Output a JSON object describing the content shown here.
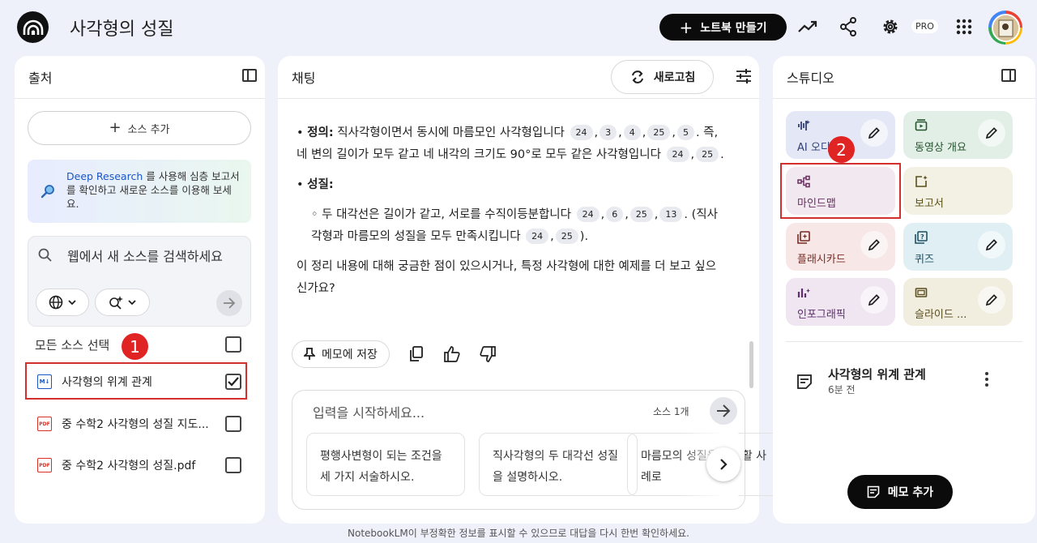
{
  "header": {
    "notebook_title": "사각형의 성질",
    "new_notebook_label": "노트북 만들기",
    "pro_badge": "PRO"
  },
  "sources_panel": {
    "title": "출처",
    "add_source_label": "소스 추가",
    "deep_research": {
      "link_text": "Deep Research",
      "text": " 를 사용해 심층 보고서를 확인하고 새로운 소스를 이용해 보세요."
    },
    "search_placeholder": "웹에서 새 소스를 검색하세요",
    "select_all_label": "모든 소스 선택",
    "sources": [
      {
        "name": "사각형의 위계 관계",
        "type": "doc",
        "checked": true
      },
      {
        "name": "중 수학2 사각형의 성질 지도...",
        "type": "pdf",
        "checked": false
      },
      {
        "name": "중 수학2 사각형의 성질.pdf",
        "type": "pdf",
        "checked": false
      }
    ]
  },
  "chat_panel": {
    "title": "채팅",
    "refresh_label": "새로고침",
    "definition_label": "정의:",
    "definition_text": "직사각형이면서 동시에 마름모인 사각형입니다",
    "definition_cites": [
      "24",
      "3",
      "4",
      "25",
      "5"
    ],
    "definition_text2": "즉, 네 변의 길이가 모두 같고 네 내각의 크기도 90°로 모두 같은 사각형입니다",
    "definition_cites2": [
      "24",
      "25"
    ],
    "property_label": "성질:",
    "property_text": "두 대각선은 길이가 같고, 서로를 수직이등분합니다",
    "property_cites": [
      "24",
      "6",
      "25",
      "13"
    ],
    "property_text2": "(직사각형과 마름모의 성질을 모두 만족시킵니다",
    "property_cites2": [
      "24",
      "25"
    ],
    "closing_text": "이 정리 내용에 대해 궁금한 점이 있으시거나, 특정 사각형에 대한 예제를 더 보고 싶으신가요?",
    "save_memo_label": "메모에 저장",
    "input_placeholder": "입력을 시작하세요...",
    "source_count": "소스 1개",
    "suggestions": [
      "평행사변형이 되는 조건을 세 가지 서술하시오.",
      "직사각형의 두 대각선 성질을 설명하시오.",
      "마름모의 성질을 실생활 사례로"
    ]
  },
  "studio_panel": {
    "title": "스튜디오",
    "tiles": [
      {
        "label": "AI 오디오",
        "color": "#e4e8f6",
        "text_color": "#2f3f73"
      },
      {
        "label": "동영상 개요",
        "color": "#e2efe6",
        "text_color": "#25532e"
      },
      {
        "label": "마인드맵",
        "color": "#f1e8f0",
        "text_color": "#6a2e61"
      },
      {
        "label": "보고서",
        "color": "#f3f1e3",
        "text_color": "#5a4f1b"
      },
      {
        "label": "플래시카드",
        "color": "#f7e7e6",
        "text_color": "#7a2a24"
      },
      {
        "label": "퀴즈",
        "color": "#e0eff4",
        "text_color": "#1f5162"
      },
      {
        "label": "인포그래픽",
        "color": "#efe6f2",
        "text_color": "#5f2e6e"
      },
      {
        "label": "슬라이드 ...",
        "color": "#f1eedf",
        "text_color": "#5b4d1f"
      }
    ],
    "note_title": "사각형의 위계 관계",
    "note_time": "6분 전",
    "add_memo_label": "메모 추가"
  },
  "annotations": {
    "badge_1": "1",
    "badge_2": "2",
    "color": "#d32f2f"
  },
  "footer_text": "NotebookLM이 부정확한 정보를 표시할 수 있으므로 대답을 다시 한번 확인하세요."
}
